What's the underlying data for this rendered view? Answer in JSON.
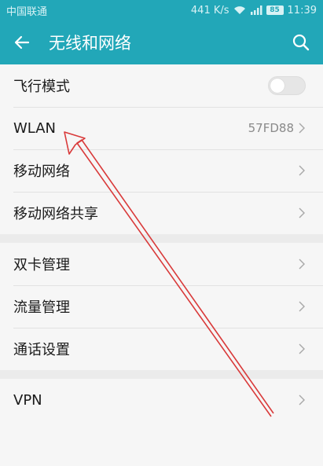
{
  "status_bar": {
    "carrier": "中国联通",
    "network_speed": "441 K/s",
    "battery": "85",
    "time": "11:39"
  },
  "header": {
    "title": "无线和网络",
    "back_icon": "arrow-left-icon",
    "search_icon": "search-icon"
  },
  "groups": [
    [
      {
        "label": "飞行模式",
        "type": "toggle",
        "on": false
      },
      {
        "label": "WLAN",
        "value": "57FD88"
      },
      {
        "label": "移动网络"
      },
      {
        "label": "移动网络共享"
      }
    ],
    [
      {
        "label": "双卡管理"
      },
      {
        "label": "流量管理"
      },
      {
        "label": "通话设置"
      }
    ],
    [
      {
        "label": "VPN"
      }
    ]
  ],
  "colors": {
    "accent": "#22a7b8",
    "annotation_arrow": "#d93a3a"
  }
}
